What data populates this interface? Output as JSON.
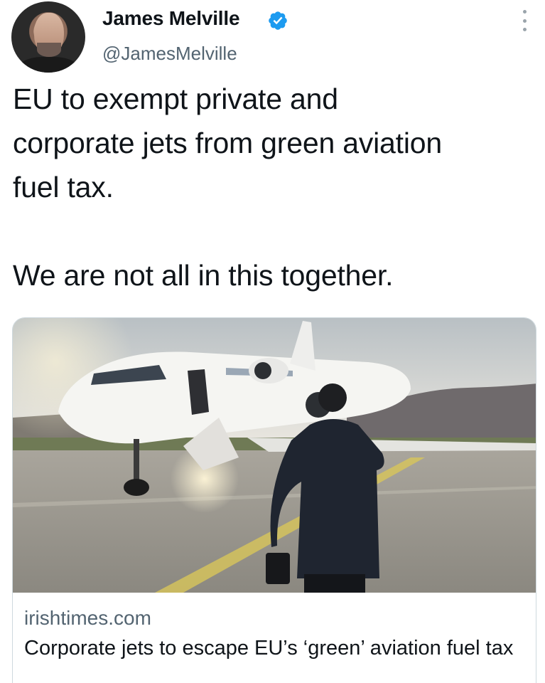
{
  "author": {
    "name": "James Melville",
    "handle": "@JamesMelville",
    "verified": true
  },
  "tweet": {
    "text": "EU to exempt private and\ncorporate jets from green aviation\nfuel tax.\n\nWe are not all in this together."
  },
  "link_card": {
    "domain": "irishtimes.com",
    "title": "Corporate jets to escape EU’s ‘green’ aviation fuel tax",
    "image": "private-jet-with-businessman-photo"
  },
  "icons": {
    "verified": "verified-badge-icon",
    "more": "more-options-icon"
  },
  "colors": {
    "verified_blue": "#1d9bf0",
    "secondary_text": "#536471",
    "card_border": "#cfd9de"
  }
}
